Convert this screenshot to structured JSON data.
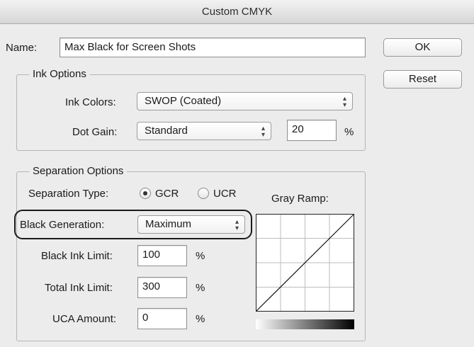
{
  "window": {
    "title": "Custom CMYK"
  },
  "name": {
    "label": "Name:",
    "value": "Max Black for Screen Shots"
  },
  "buttons": {
    "ok": "OK",
    "reset": "Reset"
  },
  "ink_options": {
    "legend": "Ink Options",
    "ink_colors_label": "Ink Colors:",
    "ink_colors_value": "SWOP (Coated)",
    "dot_gain_label": "Dot Gain:",
    "dot_gain_value": "Standard",
    "dot_gain_amount": "20",
    "percent": "%"
  },
  "separation_options": {
    "legend": "Separation Options",
    "separation_type_label": "Separation Type:",
    "gcr_label": "GCR",
    "ucr_label": "UCR",
    "selected_type": "GCR",
    "gray_ramp_label": "Gray Ramp:",
    "black_generation_label": "Black Generation:",
    "black_generation_value": "Maximum",
    "black_ink_limit_label": "Black Ink Limit:",
    "black_ink_limit_value": "100",
    "total_ink_limit_label": "Total Ink Limit:",
    "total_ink_limit_value": "300",
    "uca_amount_label": "UCA Amount:",
    "uca_amount_value": "0",
    "percent": "%"
  },
  "icons": {
    "popup_arrows": "up-down-arrows-icon",
    "radio_selected": "radio-selected-icon"
  }
}
